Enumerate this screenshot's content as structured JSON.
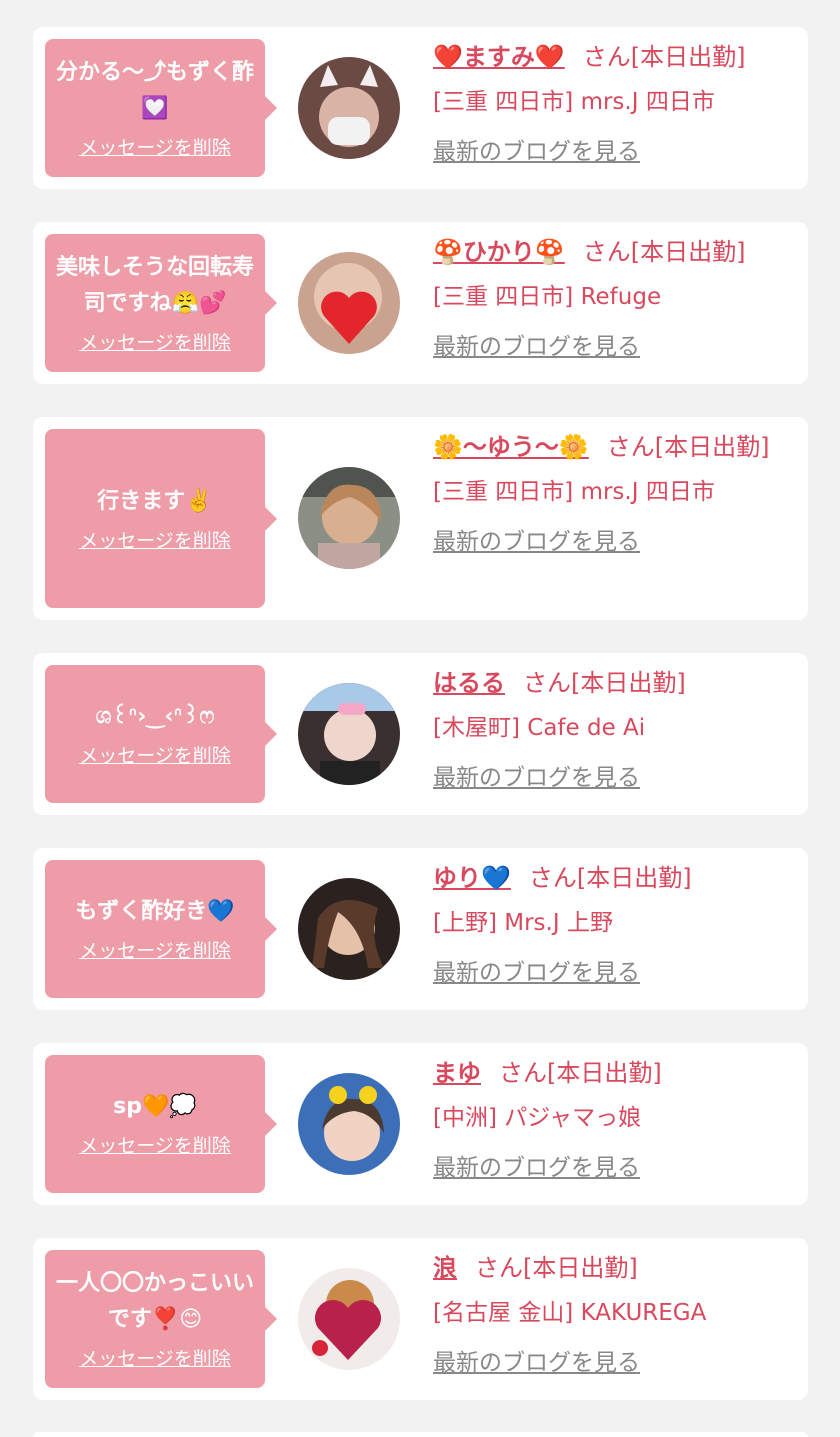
{
  "delete_label": "メッセージを削除",
  "blog_label": "最新のブログを見る",
  "cards": [
    {
      "message": "分かる〜⤴︎もずく酢💟",
      "name": "❤️ますみ❤️",
      "status": "さん[本日出勤]",
      "shop": "[三重 四日市] mrs.J 四日市",
      "avatar_icon": "avatar-photo-cat-ears"
    },
    {
      "message": "美味しそうな回転寿司ですね😤💕",
      "name": "🍄ひかり🍄",
      "status": "さん[本日出勤]",
      "shop": "[三重 四日市] Refuge",
      "avatar_icon": "avatar-photo-heart-face"
    },
    {
      "message": "行きます✌️",
      "name": "🌼〜ゆう〜🌼",
      "status": "さん[本日出勤]",
      "shop": "[三重 四日市] mrs.J 四日市",
      "avatar_icon": "avatar-photo-car"
    },
    {
      "message": "ශ꒰ᐢ›‿‹ᐢ꒱ෆ",
      "name": "はるる",
      "status": "さん[本日出勤]",
      "shop": "[木屋町] Cafe de Ai",
      "avatar_icon": "avatar-photo-maid"
    },
    {
      "message": "もずく酢好き💙",
      "name": "ゆり💙",
      "status": "さん[本日出勤]",
      "shop": "[上野] Mrs.J 上野",
      "avatar_icon": "avatar-photo-selfie"
    },
    {
      "message": "sp🧡💭",
      "name": "まゆ",
      "status": "さん[本日出勤]",
      "shop": "[中洲] パジャマっ娘",
      "avatar_icon": "avatar-photo-ducks"
    },
    {
      "message": "一人〇〇かっこいいです❣️😊",
      "name": "浪",
      "status": "さん[本日出勤]",
      "shop": "[名古屋 金山] KAKUREGA",
      "avatar_icon": "avatar-photo-glitter-heart"
    }
  ]
}
